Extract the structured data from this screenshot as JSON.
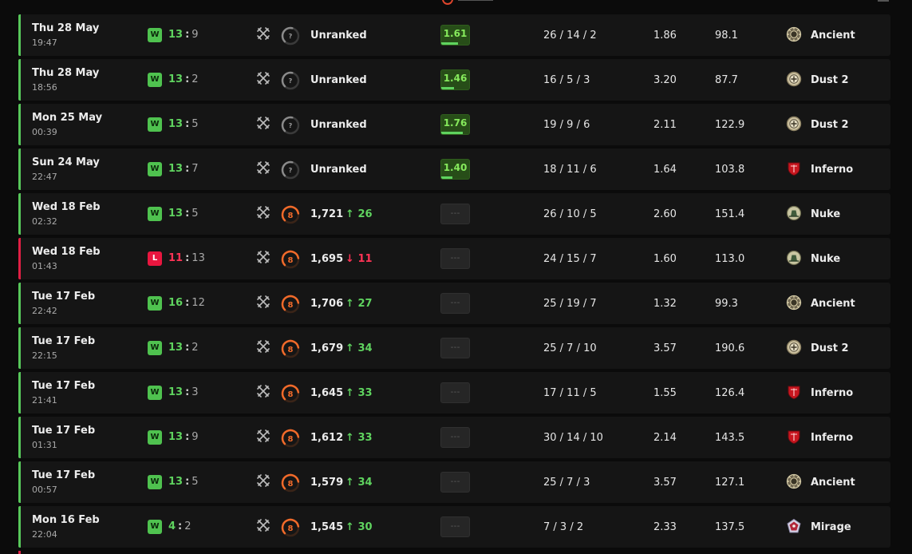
{
  "matches": [
    {
      "outcome": "win",
      "result_badge": "W",
      "date": "Thu 28 May",
      "time": "19:47",
      "score_team": "13",
      "score_sep": ":",
      "score_opp": "9",
      "rank_type": "unranked",
      "rank_level": "?",
      "rank_text": "Unranked",
      "rank_arrow": "",
      "rank_delta": "",
      "rating": "1.61",
      "rating_fraction": 0.61,
      "kda": "26 / 14 / 2",
      "kd": "1.86",
      "adr": "98.1",
      "map_icon": "ancient-map-icon",
      "map": "Ancient"
    },
    {
      "outcome": "win",
      "result_badge": "W",
      "date": "Thu 28 May",
      "time": "18:56",
      "score_team": "13",
      "score_sep": ":",
      "score_opp": "2",
      "rank_type": "unranked",
      "rank_level": "?",
      "rank_text": "Unranked",
      "rank_arrow": "",
      "rank_delta": "",
      "rating": "1.46",
      "rating_fraction": 0.46,
      "kda": "16 / 5 / 3",
      "kd": "3.20",
      "adr": "87.7",
      "map_icon": "dust2-map-icon",
      "map": "Dust 2"
    },
    {
      "outcome": "win",
      "result_badge": "W",
      "date": "Mon 25 May",
      "time": "00:39",
      "score_team": "13",
      "score_sep": ":",
      "score_opp": "5",
      "rank_type": "unranked",
      "rank_level": "?",
      "rank_text": "Unranked",
      "rank_arrow": "",
      "rank_delta": "",
      "rating": "1.76",
      "rating_fraction": 0.76,
      "kda": "19 / 9 / 6",
      "kd": "2.11",
      "adr": "122.9",
      "map_icon": "dust2-map-icon",
      "map": "Dust 2"
    },
    {
      "outcome": "win",
      "result_badge": "W",
      "date": "Sun 24 May",
      "time": "22:47",
      "score_team": "13",
      "score_sep": ":",
      "score_opp": "7",
      "rank_type": "unranked",
      "rank_level": "?",
      "rank_text": "Unranked",
      "rank_arrow": "",
      "rank_delta": "",
      "rating": "1.40",
      "rating_fraction": 0.4,
      "kda": "18 / 11 / 6",
      "kd": "1.64",
      "adr": "103.8",
      "map_icon": "inferno-map-icon",
      "map": "Inferno"
    },
    {
      "outcome": "win",
      "result_badge": "W",
      "date": "Wed 18 Feb",
      "time": "02:32",
      "score_team": "13",
      "score_sep": ":",
      "score_opp": "5",
      "rank_type": "level",
      "rank_level": "8",
      "rank_text": "1,721",
      "rank_arrow": "↑",
      "rank_delta": "26",
      "rating": "---",
      "rating_fraction": 0,
      "kda": "26 / 10 / 5",
      "kd": "2.60",
      "adr": "151.4",
      "map_icon": "nuke-map-icon",
      "map": "Nuke"
    },
    {
      "outcome": "loss",
      "result_badge": "L",
      "date": "Wed 18 Feb",
      "time": "01:43",
      "score_team": "11",
      "score_sep": ":",
      "score_opp": "13",
      "rank_type": "level",
      "rank_level": "8",
      "rank_text": "1,695",
      "rank_arrow": "↓",
      "rank_delta": "11",
      "rating": "---",
      "rating_fraction": 0,
      "kda": "24 / 15 / 7",
      "kd": "1.60",
      "adr": "113.0",
      "map_icon": "nuke-map-icon",
      "map": "Nuke"
    },
    {
      "outcome": "win",
      "result_badge": "W",
      "date": "Tue 17 Feb",
      "time": "22:42",
      "score_team": "16",
      "score_sep": ":",
      "score_opp": "12",
      "rank_type": "level",
      "rank_level": "8",
      "rank_text": "1,706",
      "rank_arrow": "↑",
      "rank_delta": "27",
      "rating": "---",
      "rating_fraction": 0,
      "kda": "25 / 19 / 7",
      "kd": "1.32",
      "adr": "99.3",
      "map_icon": "ancient-map-icon",
      "map": "Ancient"
    },
    {
      "outcome": "win",
      "result_badge": "W",
      "date": "Tue 17 Feb",
      "time": "22:15",
      "score_team": "13",
      "score_sep": ":",
      "score_opp": "2",
      "rank_type": "level",
      "rank_level": "8",
      "rank_text": "1,679",
      "rank_arrow": "↑",
      "rank_delta": "34",
      "rating": "---",
      "rating_fraction": 0,
      "kda": "25 / 7 / 10",
      "kd": "3.57",
      "adr": "190.6",
      "map_icon": "dust2-map-icon",
      "map": "Dust 2"
    },
    {
      "outcome": "win",
      "result_badge": "W",
      "date": "Tue 17 Feb",
      "time": "21:41",
      "score_team": "13",
      "score_sep": ":",
      "score_opp": "3",
      "rank_type": "level",
      "rank_level": "8",
      "rank_text": "1,645",
      "rank_arrow": "↑",
      "rank_delta": "33",
      "rating": "---",
      "rating_fraction": 0,
      "kda": "17 / 11 / 5",
      "kd": "1.55",
      "adr": "126.4",
      "map_icon": "inferno-map-icon",
      "map": "Inferno"
    },
    {
      "outcome": "win",
      "result_badge": "W",
      "date": "Tue 17 Feb",
      "time": "01:31",
      "score_team": "13",
      "score_sep": ":",
      "score_opp": "9",
      "rank_type": "level",
      "rank_level": "8",
      "rank_text": "1,612",
      "rank_arrow": "↑",
      "rank_delta": "33",
      "rating": "---",
      "rating_fraction": 0,
      "kda": "30 / 14 / 10",
      "kd": "2.14",
      "adr": "143.5",
      "map_icon": "inferno-map-icon",
      "map": "Inferno"
    },
    {
      "outcome": "win",
      "result_badge": "W",
      "date": "Tue 17 Feb",
      "time": "00:57",
      "score_team": "13",
      "score_sep": ":",
      "score_opp": "5",
      "rank_type": "level",
      "rank_level": "8",
      "rank_text": "1,579",
      "rank_arrow": "↑",
      "rank_delta": "34",
      "rating": "---",
      "rating_fraction": 0,
      "kda": "25 / 7 / 3",
      "kd": "3.57",
      "adr": "127.1",
      "map_icon": "ancient-map-icon",
      "map": "Ancient"
    },
    {
      "outcome": "win",
      "result_badge": "W",
      "date": "Mon 16 Feb",
      "time": "22:04",
      "score_team": "4",
      "score_sep": ":",
      "score_opp": "2",
      "rank_type": "level",
      "rank_level": "8",
      "rank_text": "1,545",
      "rank_arrow": "↑",
      "rank_delta": "30",
      "rating": "---",
      "rating_fraction": 0,
      "kda": "7 / 3 / 2",
      "kd": "2.33",
      "adr": "137.5",
      "map_icon": "mirage-map-icon",
      "map": "Mirage"
    }
  ],
  "colors": {
    "win": "#57c75a",
    "loss": "#e01f44",
    "level_orange": "#f06a2a",
    "rating_green": "#86ea5c"
  }
}
